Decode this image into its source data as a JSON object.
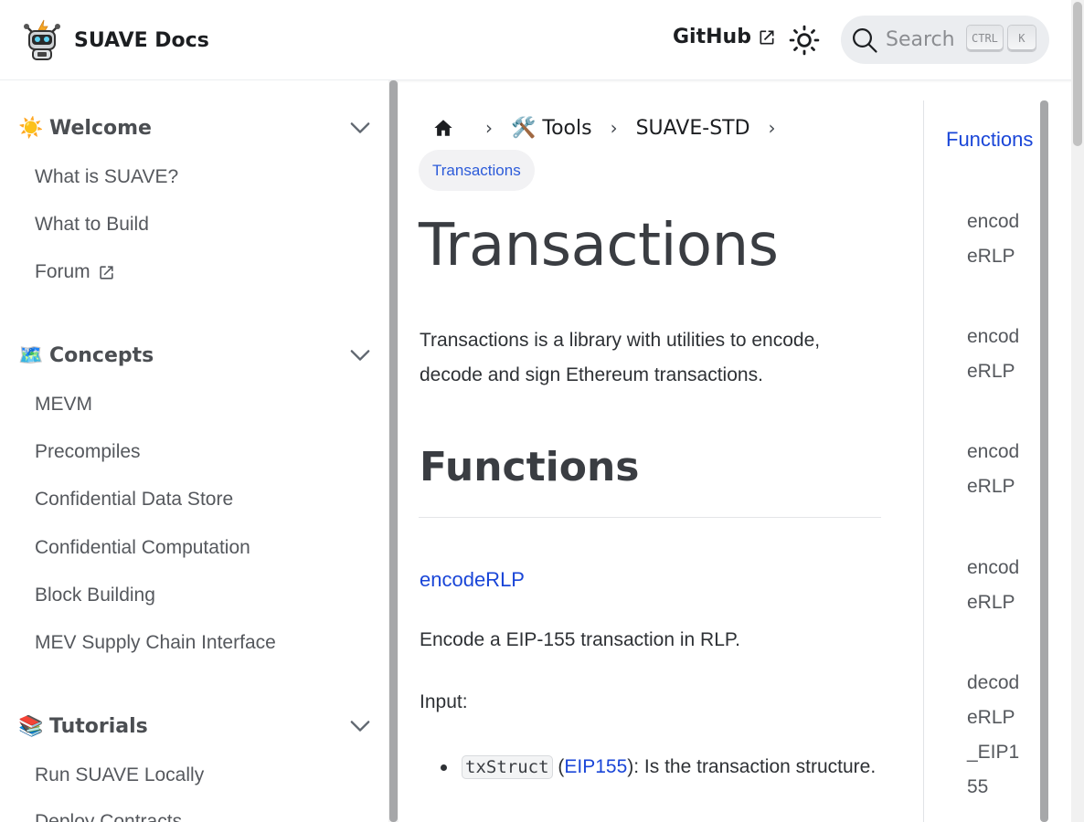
{
  "navbar": {
    "brand_title": "SUAVE Docs",
    "github_label": "GitHub",
    "search_placeholder": "Search",
    "kbd_ctrl": "CTRL",
    "kbd_k": "K",
    "accent_color": "#1a46d8"
  },
  "sidebar": {
    "categories": [
      {
        "emoji": "☀️",
        "label": "Welcome",
        "items": [
          "What is SUAVE?",
          "What to Build",
          "Forum"
        ]
      },
      {
        "emoji": "🗺️",
        "label": "Concepts",
        "items": [
          "MEVM",
          "Precompiles",
          "Confidential Data Store",
          "Confidential Computation",
          "Block Building",
          "MEV Supply Chain Interface"
        ]
      },
      {
        "emoji": "📚",
        "label": "Tutorials",
        "items": [
          "Run SUAVE Locally",
          "Deploy Contracts"
        ]
      }
    ]
  },
  "breadcrumbs": {
    "items": [
      "🛠️ Tools",
      "SUAVE-STD"
    ],
    "active": "Transactions"
  },
  "content": {
    "title": "Transactions",
    "lead": "Transactions is a library with utilities to encode, decode and sign Ethereum transactions.",
    "h2": "Functions",
    "h3": "encodeRLP",
    "desc": "Encode a EIP-155 transaction in RLP.",
    "input_label": "Input:",
    "param": {
      "code": "txStruct",
      "paren_open": "(",
      "link": "EIP155",
      "rest": "): Is the transaction structure."
    }
  },
  "toc": {
    "top": "Functions",
    "items": [
      "encodeRLP",
      "encodeRLP",
      "encodeRLP",
      "encodeRLP",
      "decodeRLP_EIP155"
    ]
  }
}
